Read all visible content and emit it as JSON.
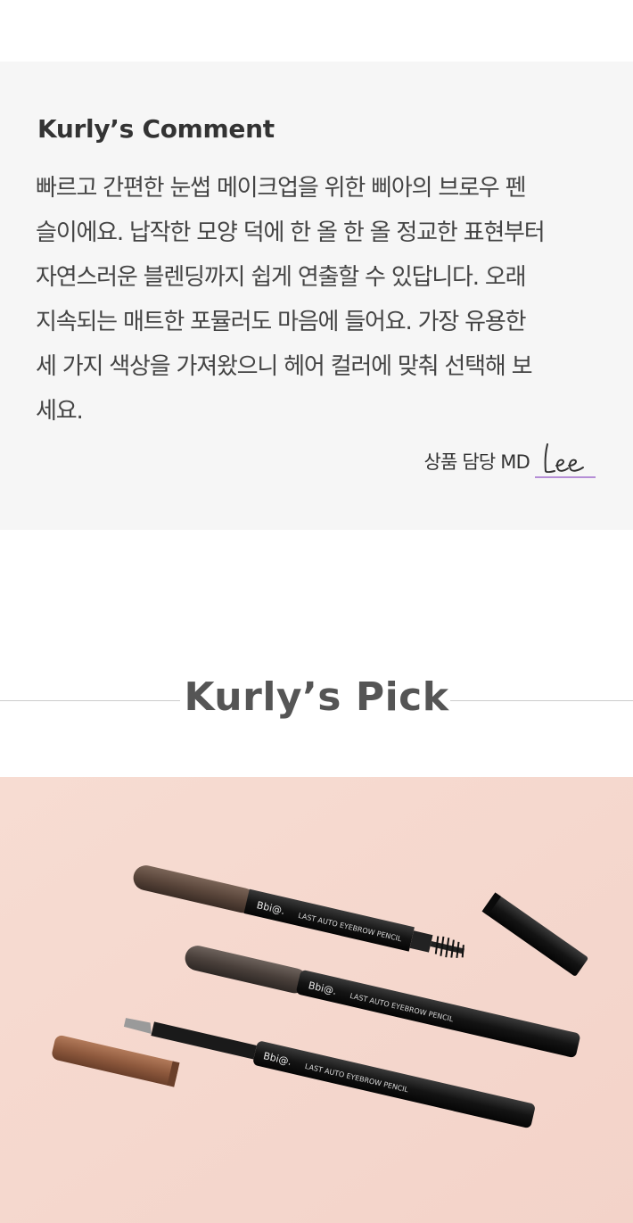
{
  "comment": {
    "title": "Kurly’s Comment",
    "lines": [
      "빠르고 간편한 눈썹 메이크업을 위한 삐아의 브로우 펜",
      "슬이에요. 납작한 모양 덕에 한 올 한 올 정교한 표현부터",
      "자연스러운 블렌딩까지 쉽게 연출할 수 있답니다. 오래",
      "지속되는 매트한 포뮬러도 마음에 들어요. 가장 유용한",
      "세 가지 색상을 가져왔으니 헤어 컬러에 맞춰 선택해 보",
      "세요."
    ],
    "md_label": "상품 담당 MD",
    "signature": "Lee",
    "signature_color": "#b58ed6"
  },
  "pick": {
    "title": "Kurly’s Pick"
  },
  "product": {
    "brand": "Bbi@.",
    "pencil_text": "LAST AUTO EYEBROW PENCIL",
    "background_color": "#f6d9d0"
  }
}
